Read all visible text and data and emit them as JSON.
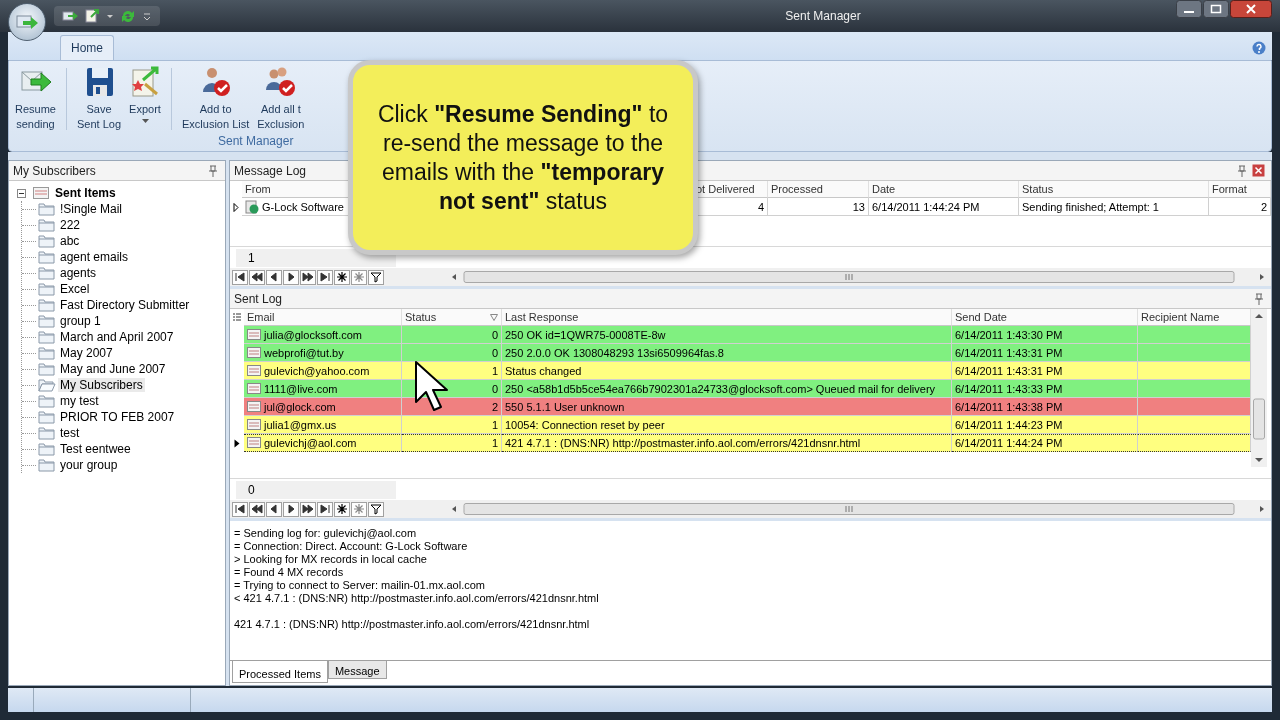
{
  "window": {
    "title": "Sent Manager"
  },
  "ribbon": {
    "tabs": [
      {
        "label": "Home",
        "selected": true
      }
    ],
    "buttons": [
      {
        "lines": [
          "Resume",
          "sending"
        ],
        "dropdown": false
      },
      {
        "lines": [
          "Save",
          "Sent Log"
        ],
        "dropdown": false
      },
      {
        "lines": [
          "Export"
        ],
        "dropdown": true
      },
      {
        "lines": [
          "Add to",
          "Exclusion List"
        ],
        "dropdown": false
      },
      {
        "lines": [
          "Add all t",
          "Exclusion"
        ],
        "dropdown": false
      }
    ],
    "group": "Sent Manager"
  },
  "callout": {
    "text": "Click **\"Resume Sending\"** to re-send the message to the emails with the **\"temporary not sent\"** status"
  },
  "sidebar": {
    "title": "My Subscribers",
    "tree": [
      {
        "label": "Sent Items",
        "expanded": true,
        "children": [
          {
            "label": "!Single Mail",
            "selected": false
          },
          {
            "label": "222",
            "selected": false
          },
          {
            "label": "abc",
            "selected": false
          },
          {
            "label": "agent emails",
            "selected": false
          },
          {
            "label": "agents",
            "selected": false
          },
          {
            "label": "Excel",
            "selected": false
          },
          {
            "label": "Fast Directory Submitter",
            "selected": false
          },
          {
            "label": "group 1",
            "selected": false
          },
          {
            "label": "March and April 2007",
            "selected": false
          },
          {
            "label": "May 2007",
            "selected": false
          },
          {
            "label": "May and June 2007",
            "selected": false
          },
          {
            "label": "My Subscribers",
            "selected": true
          },
          {
            "label": "my test",
            "selected": false
          },
          {
            "label": "PRIOR TO FEB 2007",
            "selected": false
          },
          {
            "label": "test",
            "selected": false
          },
          {
            "label": "Test eentwee",
            "selected": false
          },
          {
            "label": "your group",
            "selected": false
          }
        ]
      }
    ]
  },
  "message_log": {
    "title": "Message Log",
    "columns": [
      "From",
      "ot Delivered",
      "Processed",
      "Date",
      "Status",
      "Format"
    ],
    "rows": [
      {
        "selected": true,
        "cells": [
          "G-Lock Software",
          "4",
          "13",
          "6/14/2011 1:44:24 PM",
          "Sending finished; Attempt: 1",
          "2"
        ]
      }
    ],
    "footer": "1"
  },
  "sent_log": {
    "title": "Sent Log",
    "columns": [
      "Email",
      "Status",
      "Last Response",
      "Send Date",
      "Recipient Name"
    ],
    "rows": [
      {
        "selected": false,
        "color": "#80f080",
        "cells": [
          "julia@glocksoft.com",
          "0",
          "250 OK id=1QWR75-0008TE-8w",
          "6/14/2011 1:43:30 PM"
        ]
      },
      {
        "selected": false,
        "color": "#80f080",
        "cells": [
          "webprofi@tut.by",
          "0",
          "250 2.0.0 OK 1308048293 13si6509964fas.8",
          "6/14/2011 1:43:31 PM"
        ]
      },
      {
        "selected": false,
        "color": "#ffff80",
        "cells": [
          "gulevich@yahoo.com",
          "1",
          "Status changed",
          "6/14/2011 1:43:31 PM"
        ]
      },
      {
        "selected": false,
        "color": "#80f080",
        "cells": [
          "1111@live.com",
          "0",
          "250  <a58b1d5b5ce54ea766b7902301a24733@glocksoft.com> Queued mail for delivery",
          "6/14/2011 1:43:33 PM"
        ]
      },
      {
        "selected": false,
        "color": "#f08080",
        "cells": [
          "jul@glock.com",
          "2",
          "550 5.1.1 User unknown",
          "6/14/2011 1:43:38 PM"
        ]
      },
      {
        "selected": false,
        "color": "#ffff80",
        "cells": [
          "julia1@gmx.us",
          "1",
          "10054: Connection reset by peer",
          "6/14/2011 1:44:23 PM"
        ]
      },
      {
        "selected": true,
        "color": "#ffff80",
        "cells": [
          "gulevichj@aol.com",
          "1",
          "421 4.7.1 : (DNS:NR) http://postmaster.info.aol.com/errors/421dnsnr.html",
          "6/14/2011 1:44:24 PM"
        ]
      }
    ],
    "footer": "0"
  },
  "log_text": {
    "paragraphs": [
      [
        "= Sending log for: gulevichj@aol.com",
        "= Connection: Direct. Account: G-Lock Software",
        "> Looking for MX records in local cache",
        "= Found 4 MX records",
        "= Trying to connect to Server: mailin-01.mx.aol.com",
        "< 421 4.7.1 : (DNS:NR) http://postmaster.info.aol.com/errors/421dnsnr.html"
      ],
      [
        "421 4.7.1 : (DNS:NR) http://postmaster.info.aol.com/errors/421dnsnr.html"
      ]
    ]
  },
  "bottom_tabs": [
    {
      "label": "Processed Items",
      "selected": true
    },
    {
      "label": "Message",
      "selected": false
    }
  ]
}
